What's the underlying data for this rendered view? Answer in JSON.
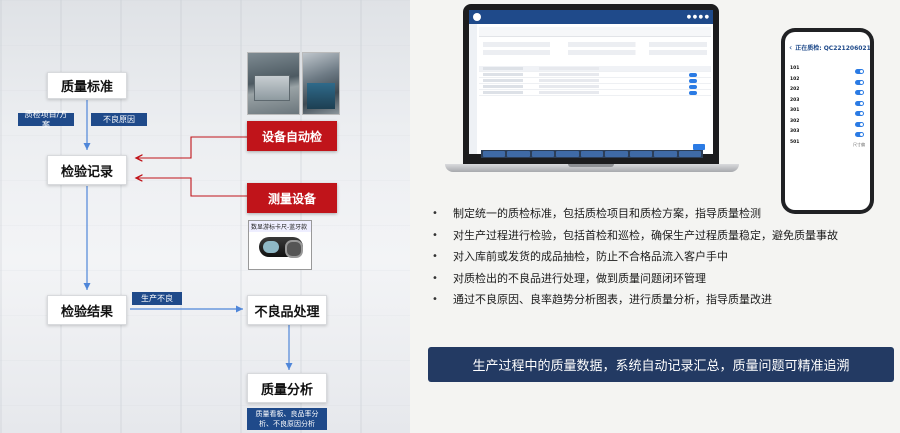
{
  "flow": {
    "quality_standard": "质量标准",
    "tag_items_plans": "质检项目/方案",
    "tag_defect_reasons": "不良原因",
    "inspection_record": "检验记录",
    "auto_inspection": "设备自动检",
    "measuring_device": "测量设备",
    "device_card_title": "数显游标卡尺-蓝牙款",
    "inspection_result": "检验结果",
    "tag_production_defect": "生产不良",
    "defect_handling": "不良品处理",
    "quality_analysis": "质量分析",
    "tag_analysis_detail": "质量看板、良品率分析、不良原因分析"
  },
  "phone": {
    "title": "正在质检: QC2212060216",
    "items": [
      {
        "code": "101",
        "has_toggle": true
      },
      {
        "code": "102",
        "has_toggle": true
      },
      {
        "code": "202",
        "has_toggle": true
      },
      {
        "code": "203",
        "has_toggle": true
      },
      {
        "code": "301",
        "has_toggle": true
      },
      {
        "code": "302",
        "has_toggle": true
      },
      {
        "code": "303",
        "has_toggle": true
      },
      {
        "code": "501",
        "value": "尺寸偏"
      }
    ]
  },
  "bullets": [
    "制定统一的质检标准，包括质检项目和质检方案，指导质量检测",
    "对生产过程进行检验，包括首检和巡检，确保生产过程质量稳定，避免质量事故",
    "对入库前或发货的成品抽检，防止不合格品流入客户手中",
    "对质检出的不良品进行处理，做到质量问题闭环管理",
    "通过不良原因、良率趋势分析图表，进行质量分析，指导质量改进"
  ],
  "banner": "生产过程中的质量数据，系统自动记录汇总，质量问题可精准追溯",
  "colors": {
    "navy": "#233a63",
    "accent_red": "#c0141a",
    "tag_blue": "#1f4a8a",
    "arrow_blue": "#4f86d9",
    "arrow_red": "#c0141a"
  }
}
